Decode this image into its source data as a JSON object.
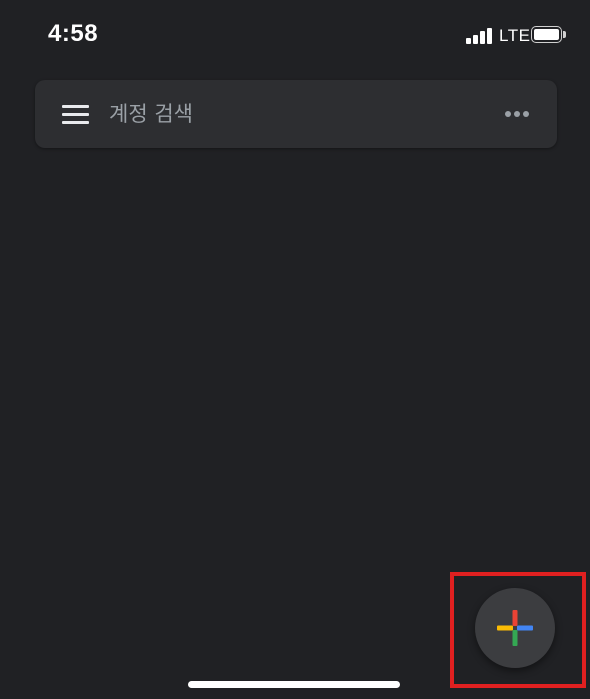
{
  "status_bar": {
    "time": "4:58",
    "network": "LTE",
    "signal_bars": 4,
    "battery_level": 1.0
  },
  "search_bar": {
    "placeholder": "계정 검색",
    "value": "",
    "menu_icon": "hamburger-menu-icon",
    "more_icon": "more-horizontal-icon"
  },
  "fab": {
    "icon": "add-icon",
    "colors": {
      "top": "#ea4335",
      "right": "#4285f4",
      "bottom": "#34a853",
      "left": "#fbbc04"
    },
    "highlight_color": "#e02020"
  },
  "colors": {
    "background": "#202124",
    "surface": "#2d2e31",
    "text": "#e8eaed",
    "placeholder": "#9aa0a6"
  }
}
